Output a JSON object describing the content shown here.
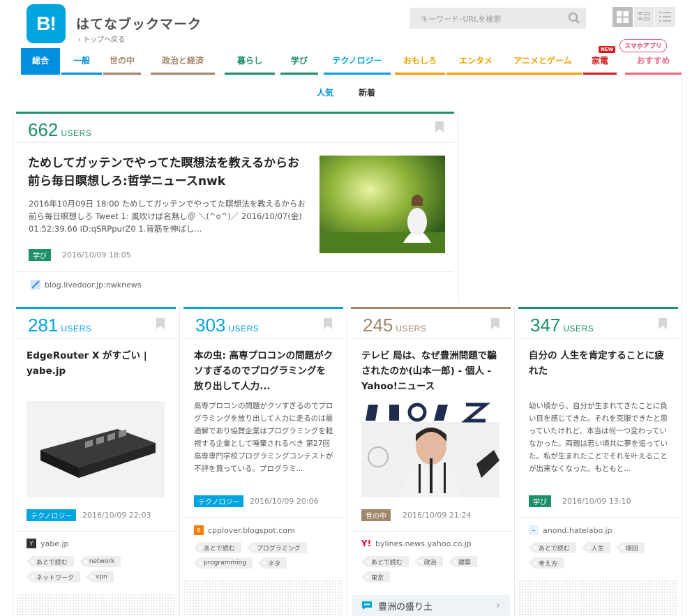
{
  "header": {
    "logo_text": "B!",
    "site_title": "はてなブックマーク",
    "back_link": "‹ トップへ戻る",
    "search_placeholder": "キーワード･URLを検索"
  },
  "categories": [
    {
      "label": "総合",
      "color": "#008fde",
      "active": true
    },
    {
      "label": "一般",
      "color": "#008fde"
    },
    {
      "label": "世の中",
      "color": "#a2866a"
    },
    {
      "label": "政治と経済",
      "color": "#a2866a"
    },
    {
      "label": "暮らし",
      "color": "#1d8f6a"
    },
    {
      "label": "学び",
      "color": "#1d8f6a"
    },
    {
      "label": "テクノロジー",
      "color": "#00a4de"
    },
    {
      "label": "おもしろ",
      "color": "#f0a200"
    },
    {
      "label": "エンタメ",
      "color": "#f0a200"
    },
    {
      "label": "アニメとゲーム",
      "color": "#f0a200"
    },
    {
      "label": "家電",
      "color": "#d21c1c"
    },
    {
      "label": "おすすめ",
      "color": "#e66a88"
    }
  ],
  "badges": {
    "new": "NEW",
    "app": "スマホアプリ"
  },
  "subtabs": {
    "popular": "人気",
    "new": "新着"
  },
  "featured": {
    "count": "662",
    "users": "USERS",
    "title": "ためしてガッテンでやってた瞑想法を教えるからお前ら毎日瞑想しろ:哲学ニュースnwk",
    "excerpt": "2016年10月09日 18:00 ためしてガッテンでやってた瞑想法を教えるからお前ら毎日瞑想しろ Tweet 1: 風吹けば名無し＠ ＼(^o^)／ 2016/10/07(金) 01:52:39.66 ID:qSRPpurZ0 1.背筋を伸ばし...",
    "category": "学び",
    "date": "2016/10/09 18:05",
    "source": "blog.livedoor.jp:nwknews",
    "color": "#1d8f6a"
  },
  "cards": [
    {
      "count": "281",
      "users": "USERS",
      "title": "EdgeRouter X がすごい | yabe.jp",
      "excerpt": "",
      "category": "テクノロジー",
      "date": "2016/10/09 22:03",
      "source": "yabe.jp",
      "tags": [
        "あとで読む",
        "network",
        "ネットワーク",
        "vpn"
      ],
      "color": "#00a4de"
    },
    {
      "count": "303",
      "users": "USERS",
      "title": "本の虫: 高専プロコンの問題がクソすぎるのでプログラミングを放り出して人力...",
      "excerpt": "高専プロコンの問題がクソすぎるのでプログラミングを放り出して人力に走るのは最適解であり協賛企業はプログラミングを軽視する企業として唾棄されるべき 第27回高専専門学校プログラミングコンテストが不評を買っている。プログラミ...",
      "category": "テクノロジー",
      "date": "2016/10/09 20:06",
      "source": "cpplover.blogspot.com",
      "tags": [
        "あとで読む",
        "プログラミング",
        "programming",
        "ネタ"
      ],
      "color": "#00a4de"
    },
    {
      "count": "245",
      "users": "USERS",
      "title": "テレビ 局は、なぜ豊洲問題で騙されたのか(山本一郎) - 個人 - Yahoo!ニュース",
      "excerpt": "",
      "category": "世の中",
      "date": "2016/10/09 21:24",
      "source": "bylines.news.yahoo.co.jp",
      "tags": [
        "あとで読む",
        "政治",
        "建築",
        "東京"
      ],
      "color": "#a2866a",
      "topic": "豊洲の盛り土"
    },
    {
      "count": "347",
      "users": "USERS",
      "title": "自分の 人生を肯定することに疲れた",
      "excerpt": "幼い頃から、自分が生まれてきたことに負い目を感じてきた。それを克服できたと思っていたけれど、本当は何一つ変わっていなかった。両親は若い頃共に夢を追っていた。私が生まれたことでそれを叶えることが出来なくなった。もともと...",
      "category": "学び",
      "date": "2016/10/09 13:10",
      "source": "anond.hatelabo.jp",
      "tags": [
        "あとで読む",
        "人生",
        "増田",
        "考え方"
      ],
      "color": "#1d8f6a"
    }
  ]
}
